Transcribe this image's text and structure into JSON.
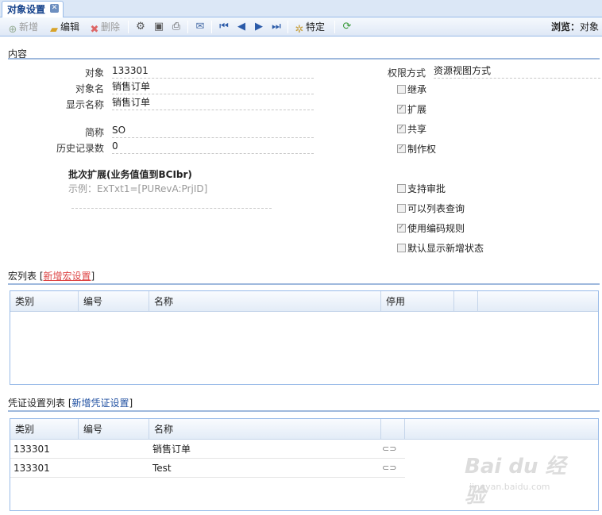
{
  "tab": {
    "title": "对象设置"
  },
  "toolbar": {
    "new": "新增",
    "edit": "编辑",
    "delete": "删除",
    "special": "特定",
    "browse_label": "浏览：",
    "browse_value": "对象"
  },
  "content": {
    "section_title": "内容",
    "fields": {
      "object_label": "对象",
      "object_value": "133301",
      "object_name_label": "对象名",
      "object_name_value": "销售订单",
      "display_name_label": "显示名称",
      "display_name_value": "销售订单",
      "abbr_label": "简称",
      "abbr_value": "SO",
      "history_label": "历史记录数",
      "history_value": "0",
      "permission_label": "权限方式",
      "permission_value": "资源视图方式"
    },
    "batch_title": "批次扩展(业务值值到BCIbr)",
    "batch_hint": "示例：ExTxt1=[PURevA:PrjID]",
    "checkboxes": [
      {
        "label": "继承",
        "checked": false
      },
      {
        "label": "扩展",
        "checked": true
      },
      {
        "label": "共享",
        "checked": true
      },
      {
        "label": "制作权",
        "checked": true
      },
      {
        "label": "支持审批",
        "checked": false
      },
      {
        "label": "可以列表查询",
        "checked": false
      },
      {
        "label": "使用编码规则",
        "checked": true
      },
      {
        "label": "默认显示新增状态",
        "checked": false
      }
    ]
  },
  "macro": {
    "title": "宏列表 [",
    "link": "新增宏设置",
    "close": "]",
    "columns": [
      "类别",
      "编号",
      "名称",
      "停用"
    ]
  },
  "voucher": {
    "title": "凭证设置列表 [",
    "link": "新增凭证设置",
    "close": "]",
    "columns": [
      "类别",
      "编号",
      "名称"
    ],
    "rows": [
      {
        "category": "133301",
        "code": "",
        "name": "销售订单"
      },
      {
        "category": "133301",
        "code": "",
        "name": "Test"
      }
    ]
  },
  "watermark": {
    "text": "Bai du 经验",
    "sub": "jingyan.baidu.com"
  }
}
